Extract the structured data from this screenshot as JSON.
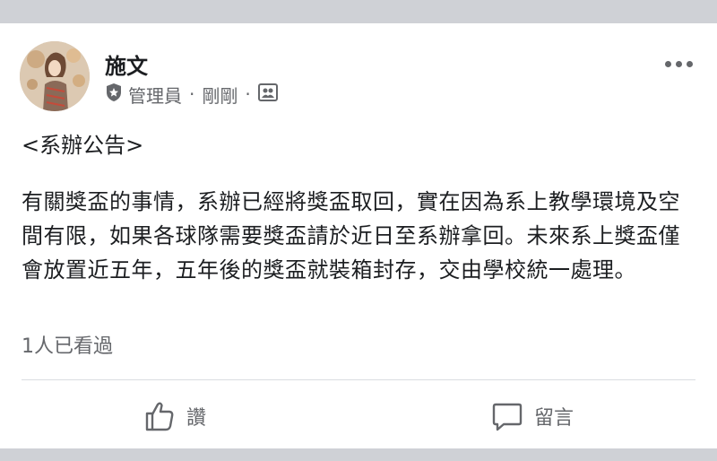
{
  "post": {
    "author": "施文",
    "role": "管理員",
    "separator": "·",
    "time": "剛剛",
    "title": "<系辦公告>",
    "body": "有關獎盃的事情，系辦已經將獎盃取回，實在因為系上教學環境及空間有限，如果各球隊需要獎盃請於近日至系辦拿回。未來系上獎盃僅會放置近五年，五年後的獎盃就裝箱封存，交由學校統一處理。",
    "seen": "1人已看過"
  },
  "actions": {
    "like_label": "讚",
    "comment_label": "留言"
  },
  "icons": {
    "admin": "admin-shield-icon",
    "audience": "group-audience-icon",
    "more": "more-options-icon",
    "like": "thumbs-up-icon",
    "comment": "comment-bubble-icon"
  },
  "colors": {
    "text": "#1c1e21",
    "secondary": "#65676b",
    "background": "#cfd1d6"
  }
}
